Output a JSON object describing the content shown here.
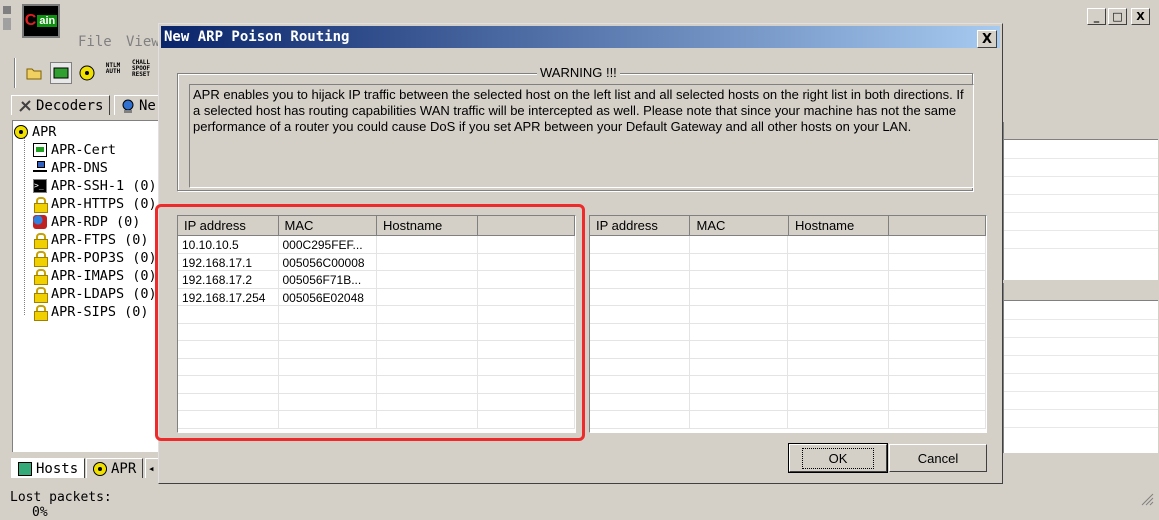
{
  "app": {
    "logo_c": "C",
    "logo_ain": "ain",
    "menu": [
      "File",
      "View"
    ],
    "window_buttons": [
      "_",
      "□",
      "X"
    ],
    "toolbar_text": [
      "NTLM\nAUTH",
      "CHALL\nSPOOF\nRESET"
    ],
    "tabs_top": [
      {
        "label": "Decoders",
        "icon": "decoders-icon"
      },
      {
        "label": "Ne",
        "icon": "network-icon"
      }
    ],
    "tree": {
      "root": "APR",
      "items": [
        {
          "label": "APR-Cert",
          "icon": "certificate-icon"
        },
        {
          "label": "APR-DNS",
          "icon": "network-icon"
        },
        {
          "label": "APR-SSH-1  (0)",
          "icon": "terminal-icon"
        },
        {
          "label": "APR-HTTPS  (0)",
          "icon": "lock-icon"
        },
        {
          "label": "APR-RDP  (0)",
          "icon": "rdp-icon"
        },
        {
          "label": "APR-FTPS  (0)",
          "icon": "lock-icon"
        },
        {
          "label": "APR-POP3S  (0)",
          "icon": "lock-icon"
        },
        {
          "label": "APR-IMAPS  (0)",
          "icon": "lock-icon"
        },
        {
          "label": "APR-LDAPS  (0)",
          "icon": "lock-icon"
        },
        {
          "label": "APR-SIPS  (0)",
          "icon": "lock-icon"
        }
      ]
    },
    "tabs_bottom": [
      {
        "label": "Hosts",
        "icon": "hosts-icon"
      },
      {
        "label": "APR",
        "icon": "radiation-icon"
      }
    ],
    "status": {
      "lost_packets_label": "Lost packets:",
      "lost_packets_value": "0%"
    }
  },
  "dialog": {
    "title": "New ARP Poison Routing",
    "close": "X",
    "warning_title": "WARNING !!!",
    "warning_text": "APR enables you to hijack IP traffic between the selected host on the left list and all selected hosts on the right list in both directions. If a selected host has routing capabilities WAN traffic will be intercepted as well. Please note that since your machine has not the same performance of a router you could cause DoS if you set APR between your Default Gateway and all other hosts on your LAN.",
    "columns": [
      "IP address",
      "MAC",
      "Hostname",
      ""
    ],
    "left_hosts": [
      {
        "ip": "10.10.10.5",
        "mac": "000C295FEF...",
        "hostname": ""
      },
      {
        "ip": "192.168.17.1",
        "mac": "005056C00008",
        "hostname": ""
      },
      {
        "ip": "192.168.17.2",
        "mac": "005056F71B...",
        "hostname": ""
      },
      {
        "ip": "192.168.17.254",
        "mac": "005056E02048",
        "hostname": ""
      }
    ],
    "ok_label": "OK",
    "cancel_label": "Cancel",
    "highlight_color": "#ee2b2b"
  }
}
